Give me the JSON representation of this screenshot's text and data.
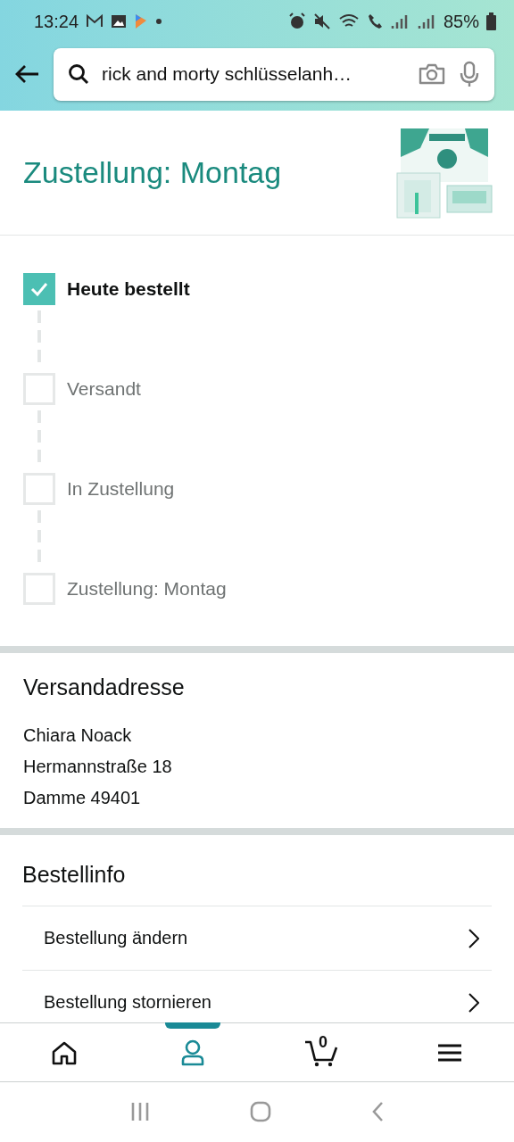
{
  "status_bar": {
    "time": "13:24",
    "battery": "85%"
  },
  "search": {
    "value": "rick and morty schlüsselanh…"
  },
  "delivery": {
    "title": "Zustellung: Montag"
  },
  "steps": [
    {
      "label": "Heute bestellt",
      "checked": true
    },
    {
      "label": "Versandt",
      "checked": false
    },
    {
      "label": "In Zustellung",
      "checked": false
    },
    {
      "label": "Zustellung: Montag",
      "checked": false
    }
  ],
  "address": {
    "heading": "Versandadresse",
    "lines": [
      "Chiara Noack",
      "Hermannstraße 18",
      "Damme 49401"
    ]
  },
  "order_info": {
    "heading": "Bestellinfo",
    "items": [
      "Bestellung ändern",
      "Bestellung stornieren"
    ]
  },
  "nav": {
    "items": [
      {
        "kind": "home",
        "selected": false
      },
      {
        "kind": "account",
        "selected": true
      },
      {
        "kind": "cart",
        "selected": false,
        "count": "0"
      },
      {
        "kind": "menu",
        "selected": false
      }
    ]
  }
}
